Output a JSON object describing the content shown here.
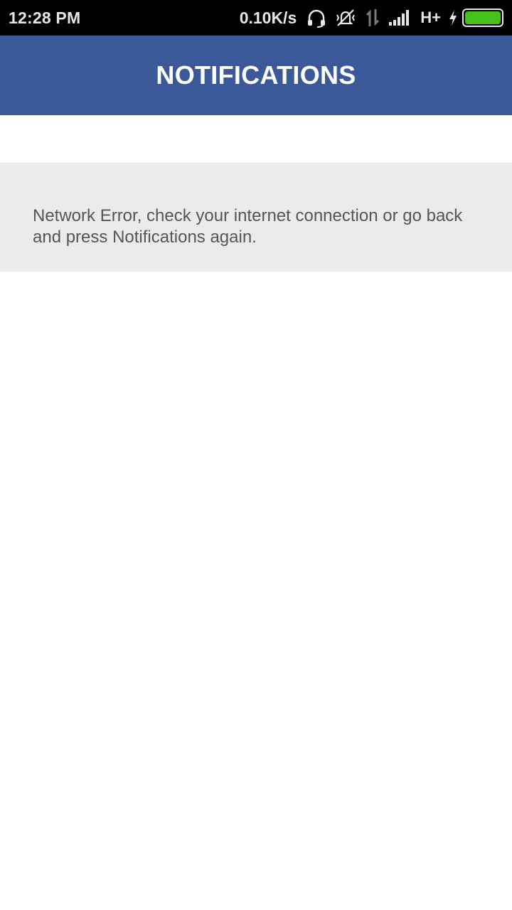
{
  "status_bar": {
    "time": "12:28 PM",
    "net_speed": "0.10K/s",
    "network_type": "H+",
    "icons": [
      "headset-icon",
      "vibrate-off-icon",
      "data-arrows-icon",
      "signal-icon",
      "charging-icon",
      "battery-icon"
    ]
  },
  "header": {
    "title": "NOTIFICATIONS"
  },
  "error": {
    "message": "Network Error, check your internet connection or go back and press Notifications again."
  },
  "colors": {
    "app_bar": "#3b5998",
    "status_bar": "#000000",
    "error_panel": "#ebebeb",
    "error_text": "#555555",
    "battery_fill": "#44c21a"
  }
}
